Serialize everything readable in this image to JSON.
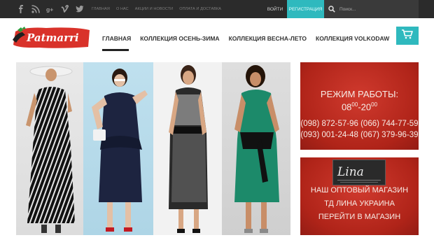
{
  "topbar": {
    "social": [
      "facebook-icon",
      "rss-icon",
      "google-plus-icon",
      "vimeo-icon",
      "twitter-icon"
    ],
    "nav": [
      "ГЛАВНАЯ",
      "О НАС",
      "АКЦИИ И НОВОСТИ",
      "ОПЛАТА И ДОСТАВКА"
    ],
    "login_label": "ВОЙТИ",
    "register_label": "РЕГИСТРАЦИЯ",
    "search_placeholder": "Поиск..."
  },
  "header": {
    "logo_text": "Patmarri",
    "nav": [
      {
        "label": "ГЛАВНАЯ",
        "active": true
      },
      {
        "label": "КОЛЛЕКЦИЯ ОСЕНЬ-ЗИМА",
        "active": false
      },
      {
        "label": "КОЛЛЕКЦИЯ ВЕСНА-ЛЕТО",
        "active": false
      },
      {
        "label": "КОЛЛЕКЦИЯ VOLKODAW",
        "active": false
      }
    ]
  },
  "promo_hours": {
    "title": "РЕЖИМ РАБОТЫ:",
    "hours_from": "08",
    "hours_from_sup": "00",
    "hours_sep": "-",
    "hours_to": "20",
    "hours_to_sup": "00",
    "phones_line1": "(098) 872-57-96 (066) 744-77-59",
    "phones_line2": "(093) 001-24-48 (067) 379-96-39"
  },
  "promo_wholesale": {
    "brand": "Lina",
    "line1": "НАШ ОПТОВЫЙ МАГАЗИН",
    "line2": "ТД ЛИНА УКРАИНА",
    "line3": "ПЕРЕЙТИ В МАГАЗИН"
  },
  "colors": {
    "accent": "#2fb9be",
    "topbar": "#2b2b2b",
    "promo_red": "#b52a21"
  }
}
